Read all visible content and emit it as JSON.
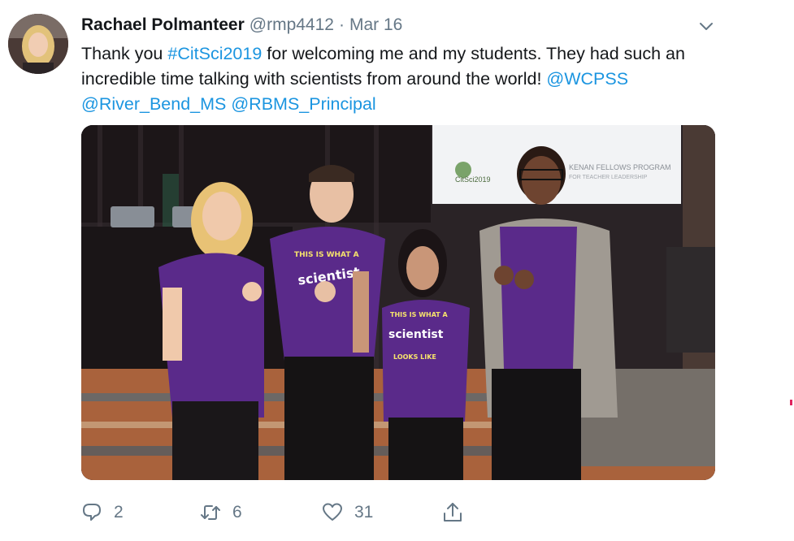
{
  "tweet": {
    "author": {
      "name": "Rachael Polmanteer",
      "handle": "@rmp4412",
      "separator": "·",
      "date": "Mar 16",
      "avatar_icon": "profile-photo-avatar"
    },
    "text": {
      "part1": "Thank you ",
      "hashtag": "#CitSci2019",
      "part2": " for welcoming me and my students. They had such an incredible time talking with scientists from around the world! ",
      "mention1": "@WCPSS",
      "space1": " ",
      "mention2": "@River_Bend_MS",
      "space2": " ",
      "mention3": "@RBMS_Principal"
    },
    "media": {
      "projector_screen_text1": "KENAN FELLOWS PROGRAM",
      "projector_screen_text2": "FOR TEACHER LEADERSHIP",
      "projector_logo_text": "CitSci2019",
      "shirt_line1": "THIS IS WHAT A",
      "shirt_line2": "scientist",
      "shirt_line3": "LOOKS LIKE"
    },
    "actions": {
      "reply_count": "2",
      "retweet_count": "6",
      "like_count": "31",
      "reply_icon": "reply-icon",
      "retweet_icon": "retweet-icon",
      "like_icon": "heart-icon",
      "share_icon": "share-icon"
    },
    "colors": {
      "link": "#1b95e0",
      "secondary_text": "#657786",
      "primary_text": "#14171a"
    }
  }
}
